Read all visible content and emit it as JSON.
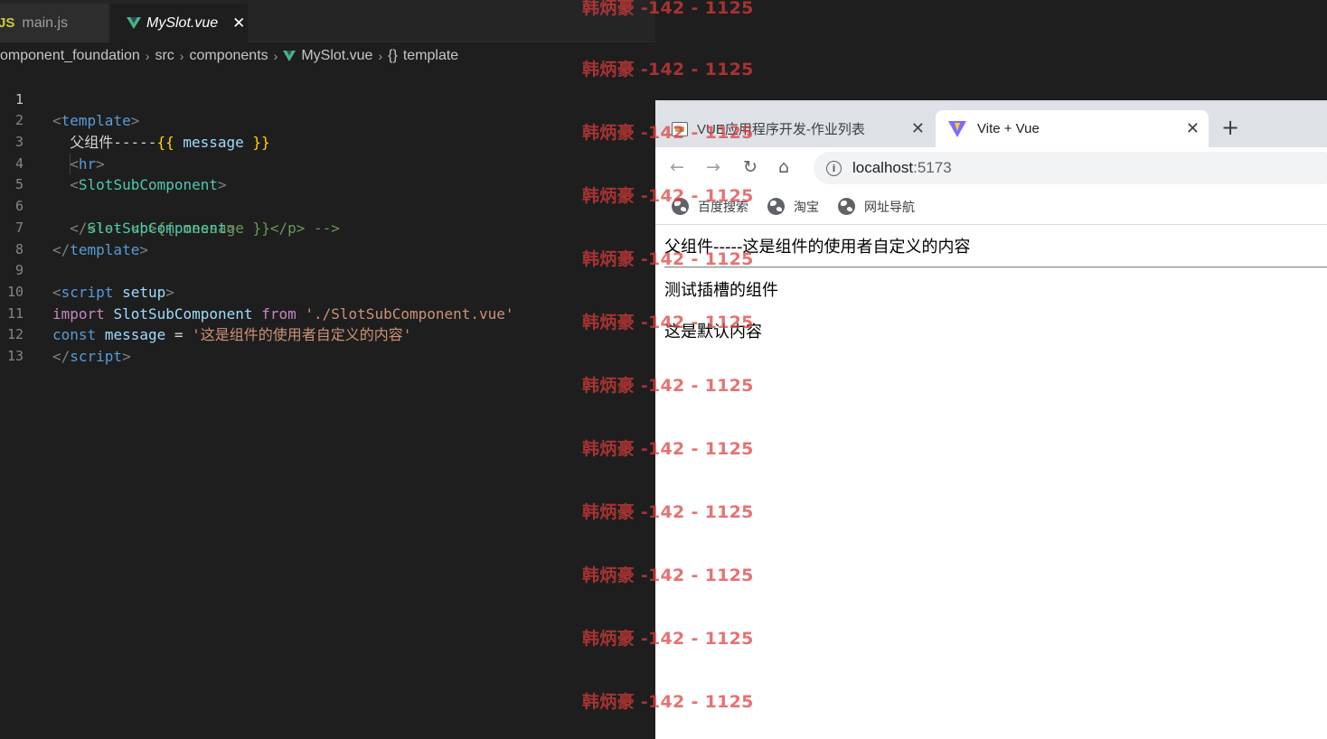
{
  "editor": {
    "tabs": [
      {
        "label": "main.js",
        "icon": "js-file-icon",
        "active": false
      },
      {
        "label": "MySlot.vue",
        "icon": "vue-file-icon",
        "active": true
      }
    ],
    "close_glyph": "✕",
    "breadcrumb": [
      "omponent_foundation",
      "src",
      "components",
      "MySlot.vue",
      "template"
    ],
    "breadcrumb_braces": "{}",
    "code_lines": [
      {
        "n": "1"
      },
      {
        "n": "2"
      },
      {
        "n": "3"
      },
      {
        "n": "4"
      },
      {
        "n": "5"
      },
      {
        "n": "6"
      },
      {
        "n": "7"
      },
      {
        "n": "8"
      },
      {
        "n": "9"
      },
      {
        "n": "10"
      },
      {
        "n": "11"
      },
      {
        "n": "12"
      },
      {
        "n": "13"
      }
    ],
    "tokens": {
      "lt": "<",
      "gt": ">",
      "close_lt": "</",
      "template": "template",
      "parent_text": "父组件-----",
      "mus_open": "{{",
      "mus_close": "}}",
      "message": "message",
      "hr": "hr",
      "slot_comp": "SlotSubComponent",
      "comment": "<!-- <p>{{ message }}</p> -->",
      "script": "script",
      "setup": "setup",
      "import": "import",
      "from": "from",
      "import_path": "'./SlotSubComponent.vue'",
      "const": "const",
      "eq": "=",
      "message_str": "'这是组件的使用者自定义的内容'"
    }
  },
  "browser": {
    "tabs": [
      {
        "title": "VUE应用程序开发-作业列表",
        "icon": "document-favicon"
      },
      {
        "title": "Vite + Vue",
        "icon": "vite-favicon",
        "active": true
      }
    ],
    "close_glyph": "✕",
    "new_tab_glyph": "+",
    "nav": {
      "back": "←",
      "forward": "→",
      "reload": "↻",
      "home": "⌂"
    },
    "url_host": "localhost",
    "url_port": ":5173",
    "info_glyph": "i",
    "bookmarks": [
      "百度搜索",
      "淘宝",
      "网址导航"
    ],
    "page": {
      "line1": "父组件-----这是组件的使用者自定义的内容",
      "line2": "测试插槽的组件",
      "line3": "这是默认内容"
    }
  },
  "watermark": {
    "text": "韩炳豪 -142 - 1125",
    "count": 12
  },
  "colors": {
    "editor_bg": "#1e1e1e",
    "tag": "#569cd6",
    "component": "#4ec9b0",
    "string": "#ce9178",
    "comment": "#6a9955",
    "keyword": "#c586c0",
    "variable": "#9cdcfe",
    "mustache": "#ffd700",
    "watermark": "#dc3c3c"
  }
}
